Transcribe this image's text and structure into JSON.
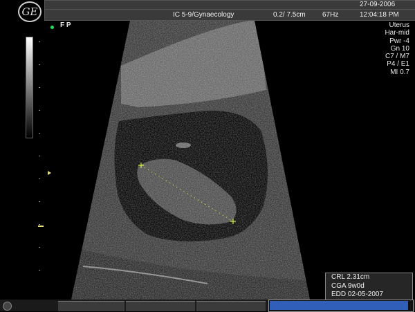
{
  "header": {
    "logo_text": "GE",
    "date": "27-09-2006",
    "probe_preset": "IC 5-9/Gynaecology",
    "depth_range": "0.2/ 7.5cm",
    "frame_rate": "67Hz",
    "time": "12:04:18 PM"
  },
  "focus_label": "F P",
  "params": [
    "Uterus",
    "Har-mid",
    "Pwr  -4",
    "Gn  10",
    "C7 / M7",
    "P4 / E1",
    "MI  0.7"
  ],
  "measurement": {
    "crl": "CRL 2.31cm",
    "cga": "CGA 9w0d",
    "edd": "EDD 02-05-2007"
  },
  "bottom_bar": {
    "progress_fraction": 0.98
  },
  "colors": {
    "focus_dot": "#22e05a",
    "caliper": "#d8f040",
    "marker": "#e8e070",
    "progress": "#2f5fb8"
  }
}
